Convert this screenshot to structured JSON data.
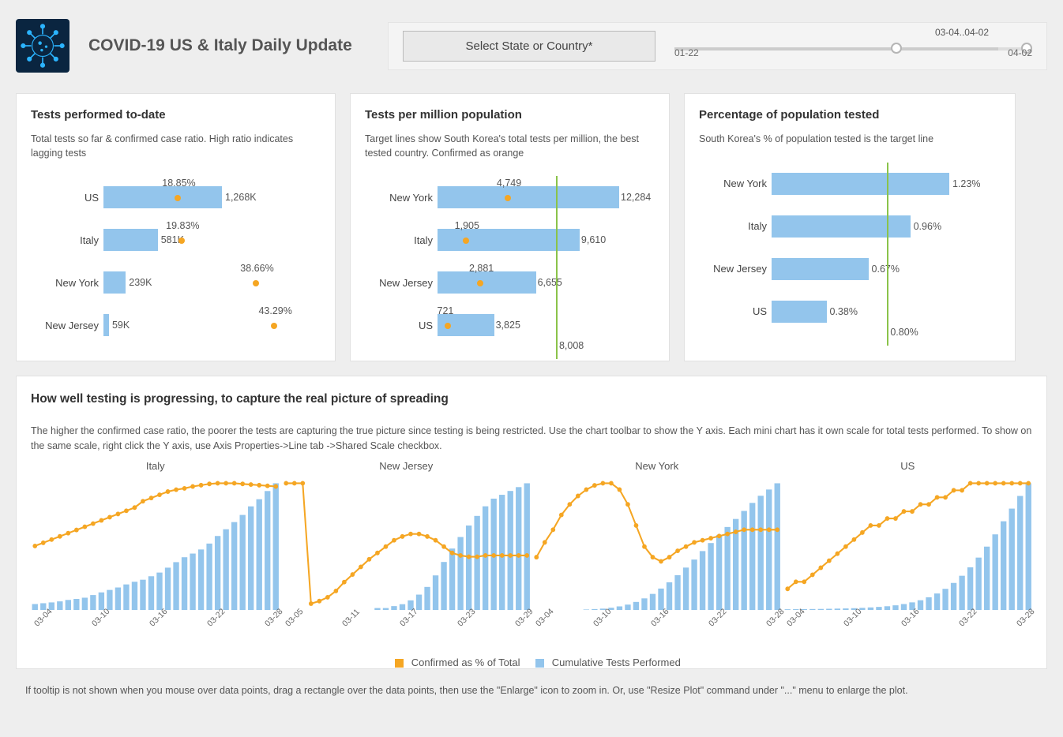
{
  "header": {
    "title": "COVID-19 US & Italy Daily Update",
    "select_button": "Select State or Country*",
    "slider": {
      "min": "01-22",
      "max": "04-02",
      "range_label": "03-04..04-02"
    }
  },
  "card1": {
    "title": "Tests performed to-date",
    "sub": "Total tests so far & confirmed case ratio. High ratio indicates lagging tests"
  },
  "card2": {
    "title": "Tests per million population",
    "sub": "Target lines show South Korea's total tests per million, the best tested country. Confirmed as orange"
  },
  "card3": {
    "title": "Percentage of population tested",
    "sub": "South Korea's % of population tested is the target line"
  },
  "big": {
    "title": "How well testing is progressing, to capture the real picture of spreading",
    "sub": "The higher the confirmed case ratio, the poorer the tests are capturing the true picture since testing is being restricted. Use the chart toolbar to show the Y axis. Each mini chart has it own scale for total tests performed. To show on the same scale, right click the Y axis, use Axis Properties->Line tab ->Shared Scale checkbox.",
    "legend_a": "Confirmed as % of Total",
    "legend_b": "Cumulative Tests Performed",
    "panels_xticks": [
      "03-04",
      "03-10",
      "03-16",
      "03-22",
      "03-28"
    ],
    "panels_xticks_nj": [
      "03-05",
      "03-11",
      "03-17",
      "03-23",
      "03-29"
    ]
  },
  "footer": "If tooltip is not shown when you mouse over data points, drag a rectangle over the data points, then use the \"Enlarge\" icon to zoom in. Or,  use \"Resize Plot\" command under \"...\" menu to enlarge the plot.",
  "chart_data": [
    {
      "id": "tests_to_date",
      "type": "bar",
      "orientation": "horizontal",
      "categories": [
        "US",
        "Italy",
        "New York",
        "New Jersey"
      ],
      "series": [
        {
          "name": "Total tests",
          "values": [
            "1,268K",
            "581K",
            "239K",
            "59K"
          ],
          "numeric": [
            1268,
            581,
            239,
            59
          ]
        },
        {
          "name": "Confirmed ratio %",
          "values": [
            "18.85%",
            "19.83%",
            "38.66%",
            "43.29%"
          ],
          "numeric": [
            18.85,
            19.83,
            38.66,
            43.29
          ]
        }
      ]
    },
    {
      "id": "tests_per_million",
      "type": "bar",
      "orientation": "horizontal",
      "target": {
        "label": "South Korea",
        "value": 8008
      },
      "categories": [
        "New York",
        "Italy",
        "New Jersey",
        "US"
      ],
      "series": [
        {
          "name": "Tests per million",
          "values": [
            12284,
            9610,
            6655,
            3825
          ]
        },
        {
          "name": "Confirmed per million",
          "values": [
            4749,
            1905,
            2881,
            721
          ]
        }
      ]
    },
    {
      "id": "pct_population_tested",
      "type": "bar",
      "orientation": "horizontal",
      "target": {
        "label": "South Korea",
        "value": 0.8,
        "display": "0.80%"
      },
      "categories": [
        "New York",
        "Italy",
        "New Jersey",
        "US"
      ],
      "series": [
        {
          "name": "% population tested",
          "values": [
            "1.23%",
            "0.96%",
            "0.67%",
            "0.38%"
          ],
          "numeric": [
            1.23,
            0.96,
            0.67,
            0.38
          ]
        }
      ]
    },
    {
      "id": "progress_small_multiples",
      "type": "small-multiples",
      "x": [
        "03-04",
        "03-05",
        "03-06",
        "03-07",
        "03-08",
        "03-09",
        "03-10",
        "03-11",
        "03-12",
        "03-13",
        "03-14",
        "03-15",
        "03-16",
        "03-17",
        "03-18",
        "03-19",
        "03-20",
        "03-21",
        "03-22",
        "03-23",
        "03-24",
        "03-25",
        "03-26",
        "03-27",
        "03-28",
        "03-29",
        "03-30",
        "03-31",
        "04-01",
        "04-02"
      ],
      "panels": [
        {
          "name": "Italy",
          "cum_tests": [
            29,
            33,
            37,
            42,
            49,
            54,
            60,
            73,
            86,
            98,
            110,
            125,
            138,
            148,
            165,
            183,
            207,
            234,
            258,
            276,
            296,
            325,
            362,
            395,
            430,
            465,
            507,
            542,
            582,
            620
          ],
          "confirmed_pct": [
            10,
            10.5,
            11,
            11.5,
            12,
            12.5,
            13,
            13.5,
            14,
            14.5,
            15,
            15.5,
            16,
            17,
            17.5,
            18,
            18.5,
            18.8,
            19,
            19.3,
            19.5,
            19.7,
            19.8,
            19.8,
            19.8,
            19.7,
            19.6,
            19.5,
            19.4,
            19.3
          ]
        },
        {
          "name": "New Jersey",
          "cum_tests": [
            0,
            0,
            0,
            0,
            0,
            0,
            0,
            0,
            0,
            0,
            0,
            1,
            1,
            2,
            3,
            5,
            8,
            12,
            18,
            25,
            32,
            38,
            44,
            49,
            54,
            58,
            60,
            62,
            64,
            66
          ],
          "confirmed_pct": [
            100,
            100,
            100,
            5,
            7,
            10,
            15,
            22,
            28,
            34,
            40,
            45,
            50,
            55,
            58,
            60,
            60,
            58,
            55,
            50,
            45,
            43,
            42,
            42,
            43,
            43,
            43,
            43,
            43,
            43
          ]
        },
        {
          "name": "New York",
          "cum_tests": [
            0,
            0,
            0,
            0,
            0,
            0,
            1,
            2,
            3,
            5,
            8,
            12,
            18,
            26,
            36,
            48,
            62,
            78,
            95,
            113,
            132,
            150,
            168,
            186,
            204,
            222,
            240,
            256,
            270,
            284
          ],
          "confirmed_pct": [
            25,
            32,
            38,
            45,
            50,
            54,
            57,
            59,
            60,
            60,
            57,
            50,
            40,
            30,
            25,
            23,
            25,
            28,
            30,
            32,
            33,
            34,
            35,
            36,
            37,
            38,
            38,
            38,
            38,
            38
          ]
        },
        {
          "name": "US",
          "cum_tests": [
            8,
            9,
            10,
            11,
            12,
            14,
            16,
            18,
            21,
            25,
            30,
            36,
            44,
            55,
            70,
            90,
            115,
            150,
            195,
            250,
            320,
            405,
            505,
            620,
            750,
            895,
            1050,
            1200,
            1350,
            1500
          ],
          "confirmed_pct": [
            3,
            4,
            4,
            5,
            6,
            7,
            8,
            9,
            10,
            11,
            12,
            12,
            13,
            13,
            14,
            14,
            15,
            15,
            16,
            16,
            17,
            17,
            18,
            18,
            18,
            18,
            18,
            18,
            18,
            18
          ]
        }
      ]
    }
  ]
}
